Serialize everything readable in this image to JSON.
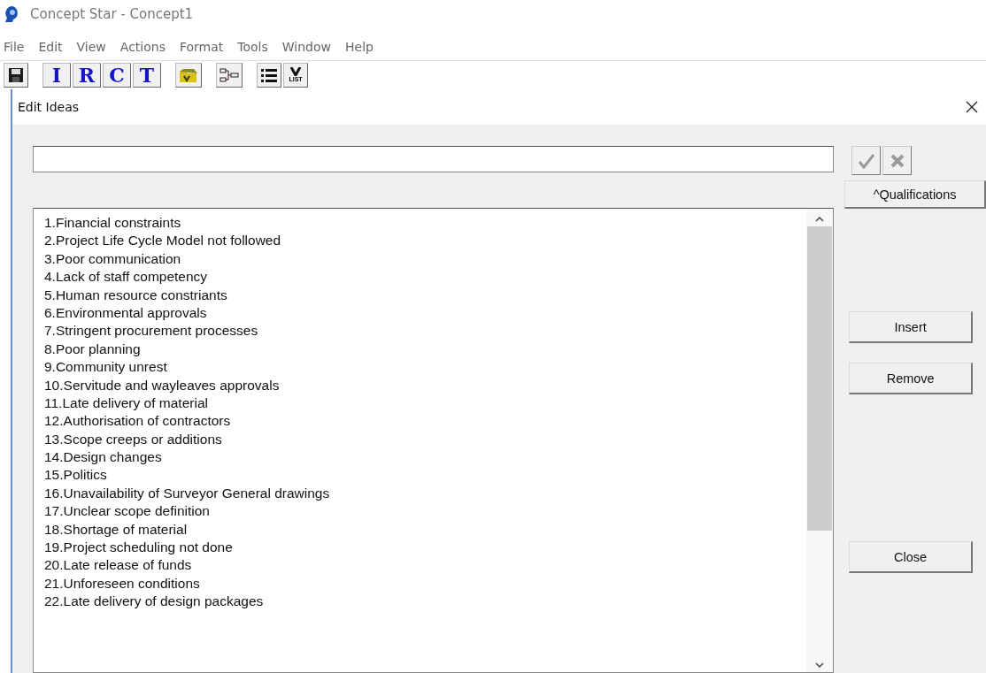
{
  "window": {
    "title": "Concept Star - Concept1"
  },
  "menu": [
    "File",
    "Edit",
    "View",
    "Actions",
    "Format",
    "Tools",
    "Window",
    "Help"
  ],
  "toolbar": {
    "letter_buttons": [
      "I",
      "R",
      "C",
      "T"
    ],
    "list_icon_label": "LIST"
  },
  "dialog": {
    "title": "Edit Ideas",
    "buttons": {
      "qualifications": "^Qualifications",
      "insert": "Insert",
      "remove": "Remove",
      "close": "Close"
    },
    "ideas": [
      "1.Financial constraints",
      "2.Project Life Cycle Model not followed",
      "3.Poor communication",
      "4.Lack of staff competency",
      "5.Human resource constriants",
      "6.Environmental approvals",
      "7.Stringent procurement processes",
      "8.Poor planning",
      "9.Community unrest",
      "10.Servitude and wayleaves approvals",
      "11.Late delivery of material",
      "12.Authorisation of contractors",
      "13.Scope creeps or additions",
      "14.Design changes",
      "15.Politics",
      "16.Unavailability of Surveyor General drawings",
      "17.Unclear scope definition",
      "18.Shortage of material",
      "19.Project scheduling not done",
      "20.Late release of funds",
      "21.Unforeseen conditions",
      "22.Late delivery of design packages"
    ]
  }
}
